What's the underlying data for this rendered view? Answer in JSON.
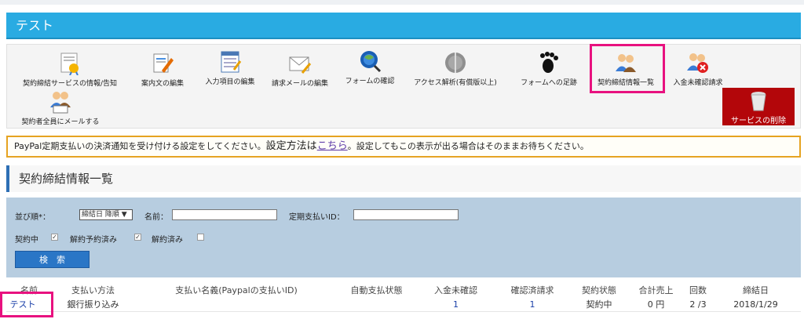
{
  "header": {
    "title": "テスト"
  },
  "toolbar": {
    "items": [
      {
        "label": "契約締結サービスの情報/告知",
        "icon": "certificate-icon"
      },
      {
        "label": "案内文の編集",
        "icon": "document-edit-icon"
      },
      {
        "label": "入力項目の編集",
        "icon": "form-list-icon"
      },
      {
        "label": "請求メールの編集",
        "icon": "mail-edit-icon"
      },
      {
        "label": "フォームの確認",
        "icon": "globe-search-icon"
      },
      {
        "label": "アクセス解析(有償版以上)",
        "icon": "analytics-icon"
      },
      {
        "label": "フォームへの足跡",
        "icon": "footprint-icon"
      },
      {
        "label": "契約締結情報一覧",
        "icon": "users-icon"
      },
      {
        "label": "入金未確認請求",
        "icon": "users-cancel-icon"
      },
      {
        "label": "契約者全員にメールする",
        "icon": "users-mail-icon"
      }
    ],
    "delete_label": "サービスの削除"
  },
  "notice": {
    "text_before": "PayPal定期支払いの決済通知を受け付ける設定をしてください。",
    "text_big": "設定方法は",
    "link": "こちら",
    "text_after": "。設定してもこの表示が出る場合はそのままお待ちください。"
  },
  "section": {
    "title": "契約締結情報一覧"
  },
  "search": {
    "sort_label": "並び順*：",
    "sort_value": "締結日 降順 ▼",
    "name_label": "名前：",
    "name_value": "",
    "sub_id_label": "定期支払いID：",
    "sub_id_value": "",
    "status_active": "契約中",
    "status_scheduled": "解約予約済み",
    "status_cancelled": "解約済み",
    "button": "検　索"
  },
  "table": {
    "headers": [
      "名前",
      "支払い方法",
      "支払い名義(Paypalの支払いID)",
      "自動支払状態",
      "入金未確認",
      "確認済請求",
      "契約状態",
      "合計売上",
      "回数",
      "締結日"
    ],
    "row": [
      "テスト",
      "銀行振り込み",
      "",
      "",
      "1",
      "1",
      "契約中",
      "0 円",
      "2 /3",
      "2018/1/29"
    ]
  },
  "colors": {
    "accent": "#29abe2",
    "highlight": "#e8117f",
    "danger": "#b3060a"
  }
}
